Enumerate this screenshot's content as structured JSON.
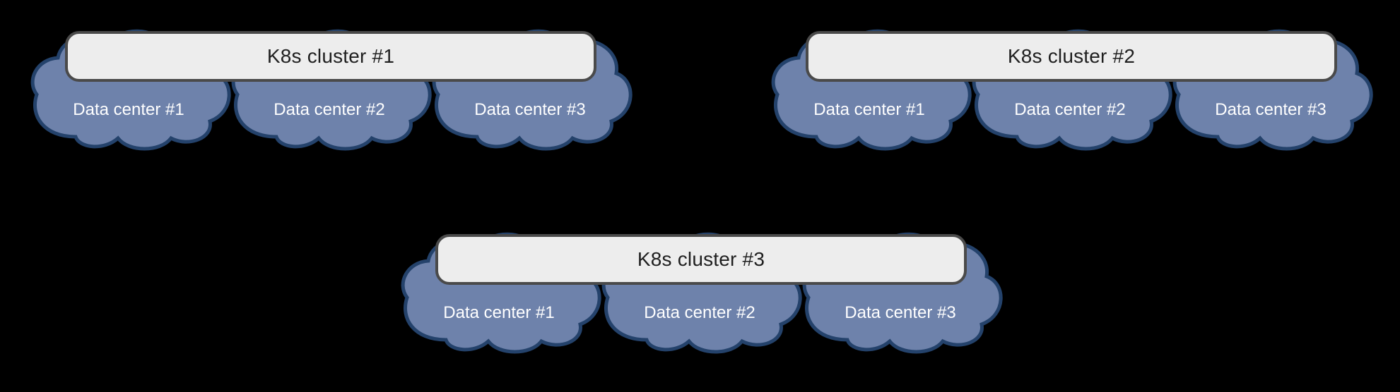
{
  "clusters": [
    {
      "title": "K8s cluster #1",
      "datacenters": [
        "Data center #1",
        "Data center #2",
        "Data center #3"
      ]
    },
    {
      "title": "K8s cluster #2",
      "datacenters": [
        "Data center #1",
        "Data center #2",
        "Data center #3"
      ]
    },
    {
      "title": "K8s cluster #3",
      "datacenters": [
        "Data center #1",
        "Data center #2",
        "Data center #3"
      ]
    }
  ],
  "colors": {
    "cloud_fill": "#6E82AB",
    "cloud_stroke": "#24426B",
    "bar_fill": "#EDEDED",
    "bar_stroke": "#4A4A4A"
  }
}
